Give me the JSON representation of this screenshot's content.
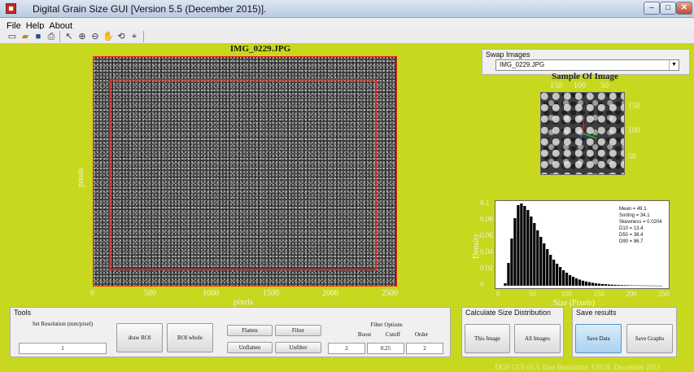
{
  "window": {
    "title": "Digital Grain Size GUI [Version 5.5 (December 2015)]."
  },
  "menu": [
    "File",
    "Help",
    "About"
  ],
  "toolbar_icons": [
    "new-icon",
    "open-icon",
    "save-icon",
    "print-icon",
    "pointer-icon",
    "zoom-in-icon",
    "zoom-out-icon",
    "pan-icon",
    "rotate-icon",
    "data-cursor-icon"
  ],
  "main_image": {
    "title": "IMG_0229.JPG",
    "ylabel": "pixels",
    "xlabel": "pixels",
    "xticks": [
      "0",
      "500",
      "1000",
      "1500",
      "2000",
      "2500"
    ]
  },
  "swap_images": {
    "legend": "Swap Images",
    "selected": "IMG_0229.JPG"
  },
  "sample_image": {
    "title": "Sample Of Image",
    "top_ticks": [
      "150",
      "100",
      "50"
    ],
    "right_ticks": [
      "150",
      "100",
      "50"
    ]
  },
  "chart_data": {
    "type": "bar",
    "xlabel": "Size (Pixels)",
    "ylabel": "Density",
    "xlim": [
      0,
      250
    ],
    "ylim": [
      0,
      0.1
    ],
    "xticks": [
      0,
      50,
      100,
      150,
      200,
      250
    ],
    "yticks": [
      0,
      0.02,
      0.04,
      0.06,
      0.08,
      0.1
    ],
    "x": [
      5,
      10,
      15,
      20,
      25,
      30,
      35,
      40,
      45,
      50,
      55,
      60,
      65,
      70,
      75,
      80,
      85,
      90,
      95,
      100,
      105,
      110,
      115,
      120,
      125,
      130,
      135,
      140,
      145,
      150,
      155,
      160,
      165,
      170,
      175,
      180,
      185,
      190,
      195,
      200,
      205,
      210,
      215,
      220,
      225,
      230,
      235,
      240,
      245
    ],
    "values": [
      0.003,
      0.028,
      0.058,
      0.083,
      0.099,
      0.101,
      0.098,
      0.093,
      0.085,
      0.077,
      0.068,
      0.06,
      0.052,
      0.045,
      0.038,
      0.032,
      0.027,
      0.023,
      0.019,
      0.016,
      0.013,
      0.011,
      0.009,
      0.0075,
      0.0062,
      0.0052,
      0.0044,
      0.0036,
      0.003,
      0.0025,
      0.0021,
      0.0018,
      0.0015,
      0.0013,
      0.0011,
      0.0009,
      0.0008,
      0.0007,
      0.0006,
      0.0005,
      0.0004,
      0.0004,
      0.0003,
      0.0003,
      0.0002,
      0.0002,
      0.0002,
      0.0001,
      0.0001
    ],
    "stats": [
      "Mean = 49.1",
      "Sorting = 34.1",
      "Skewness = 0.0204",
      "D10 = 13.4",
      "D50 = 38.4",
      "D90 = 86.7"
    ]
  },
  "tools": {
    "legend": "Tools",
    "set_resolution_label": "Set Resolution (mm/pixel)",
    "resolution_value": "1",
    "draw_roi": "draw ROI",
    "roi_whole": "ROI whole",
    "flatten": "Flatten",
    "filter": "Filter",
    "unflatten": "Unflatten",
    "unfilter": "Unfilter",
    "filter_options": "Filter Options",
    "boost_label": "Boost",
    "cutoff_label": "Cutoff",
    "order_label": "Order",
    "boost_value": "2",
    "cutoff_value": "0.25",
    "order_value": "2"
  },
  "calc": {
    "legend": "Calculate Size Distribution",
    "this_image": "This Image",
    "all_images": "All Images"
  },
  "save": {
    "legend": "Save results",
    "save_data": "Save Data",
    "save_graphs": "Save Graphs"
  },
  "footer": "DGS GUI v5.5. Dan Buscombe, USGS. December 2015"
}
